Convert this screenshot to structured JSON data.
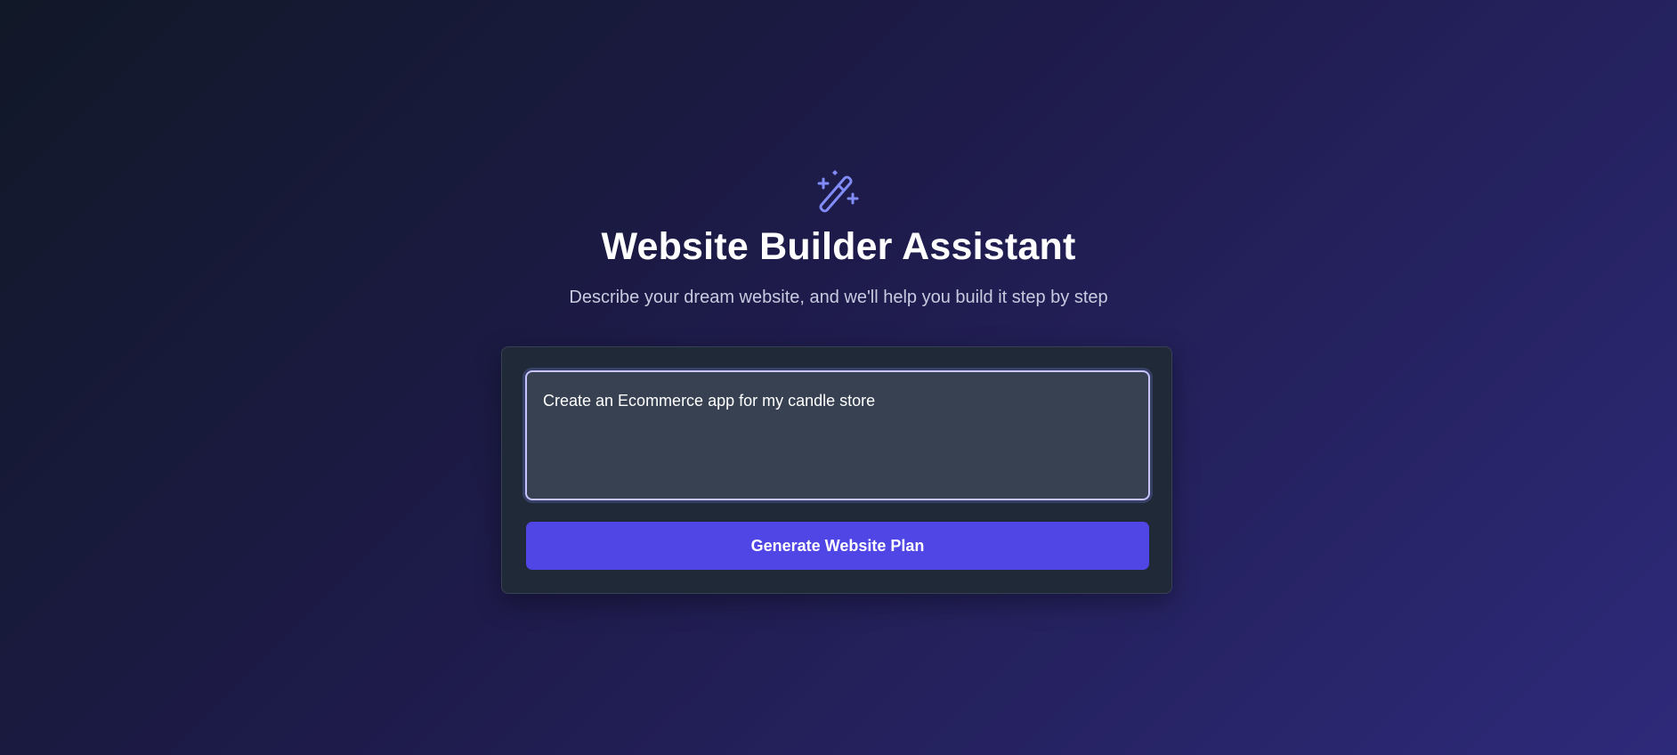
{
  "header": {
    "icon": "magic-wand-sparkles-icon",
    "title": "Website Builder Assistant",
    "subtitle": "Describe your dream website, and we'll help you build it step by step"
  },
  "form": {
    "prompt_value": "Create an Ecommerce app for my candle store",
    "submit_label": "Generate Website Plan"
  },
  "colors": {
    "accent": "#4f46e5",
    "icon": "#818cf8",
    "card_bg": "#1f2937",
    "input_bg": "#374151"
  }
}
